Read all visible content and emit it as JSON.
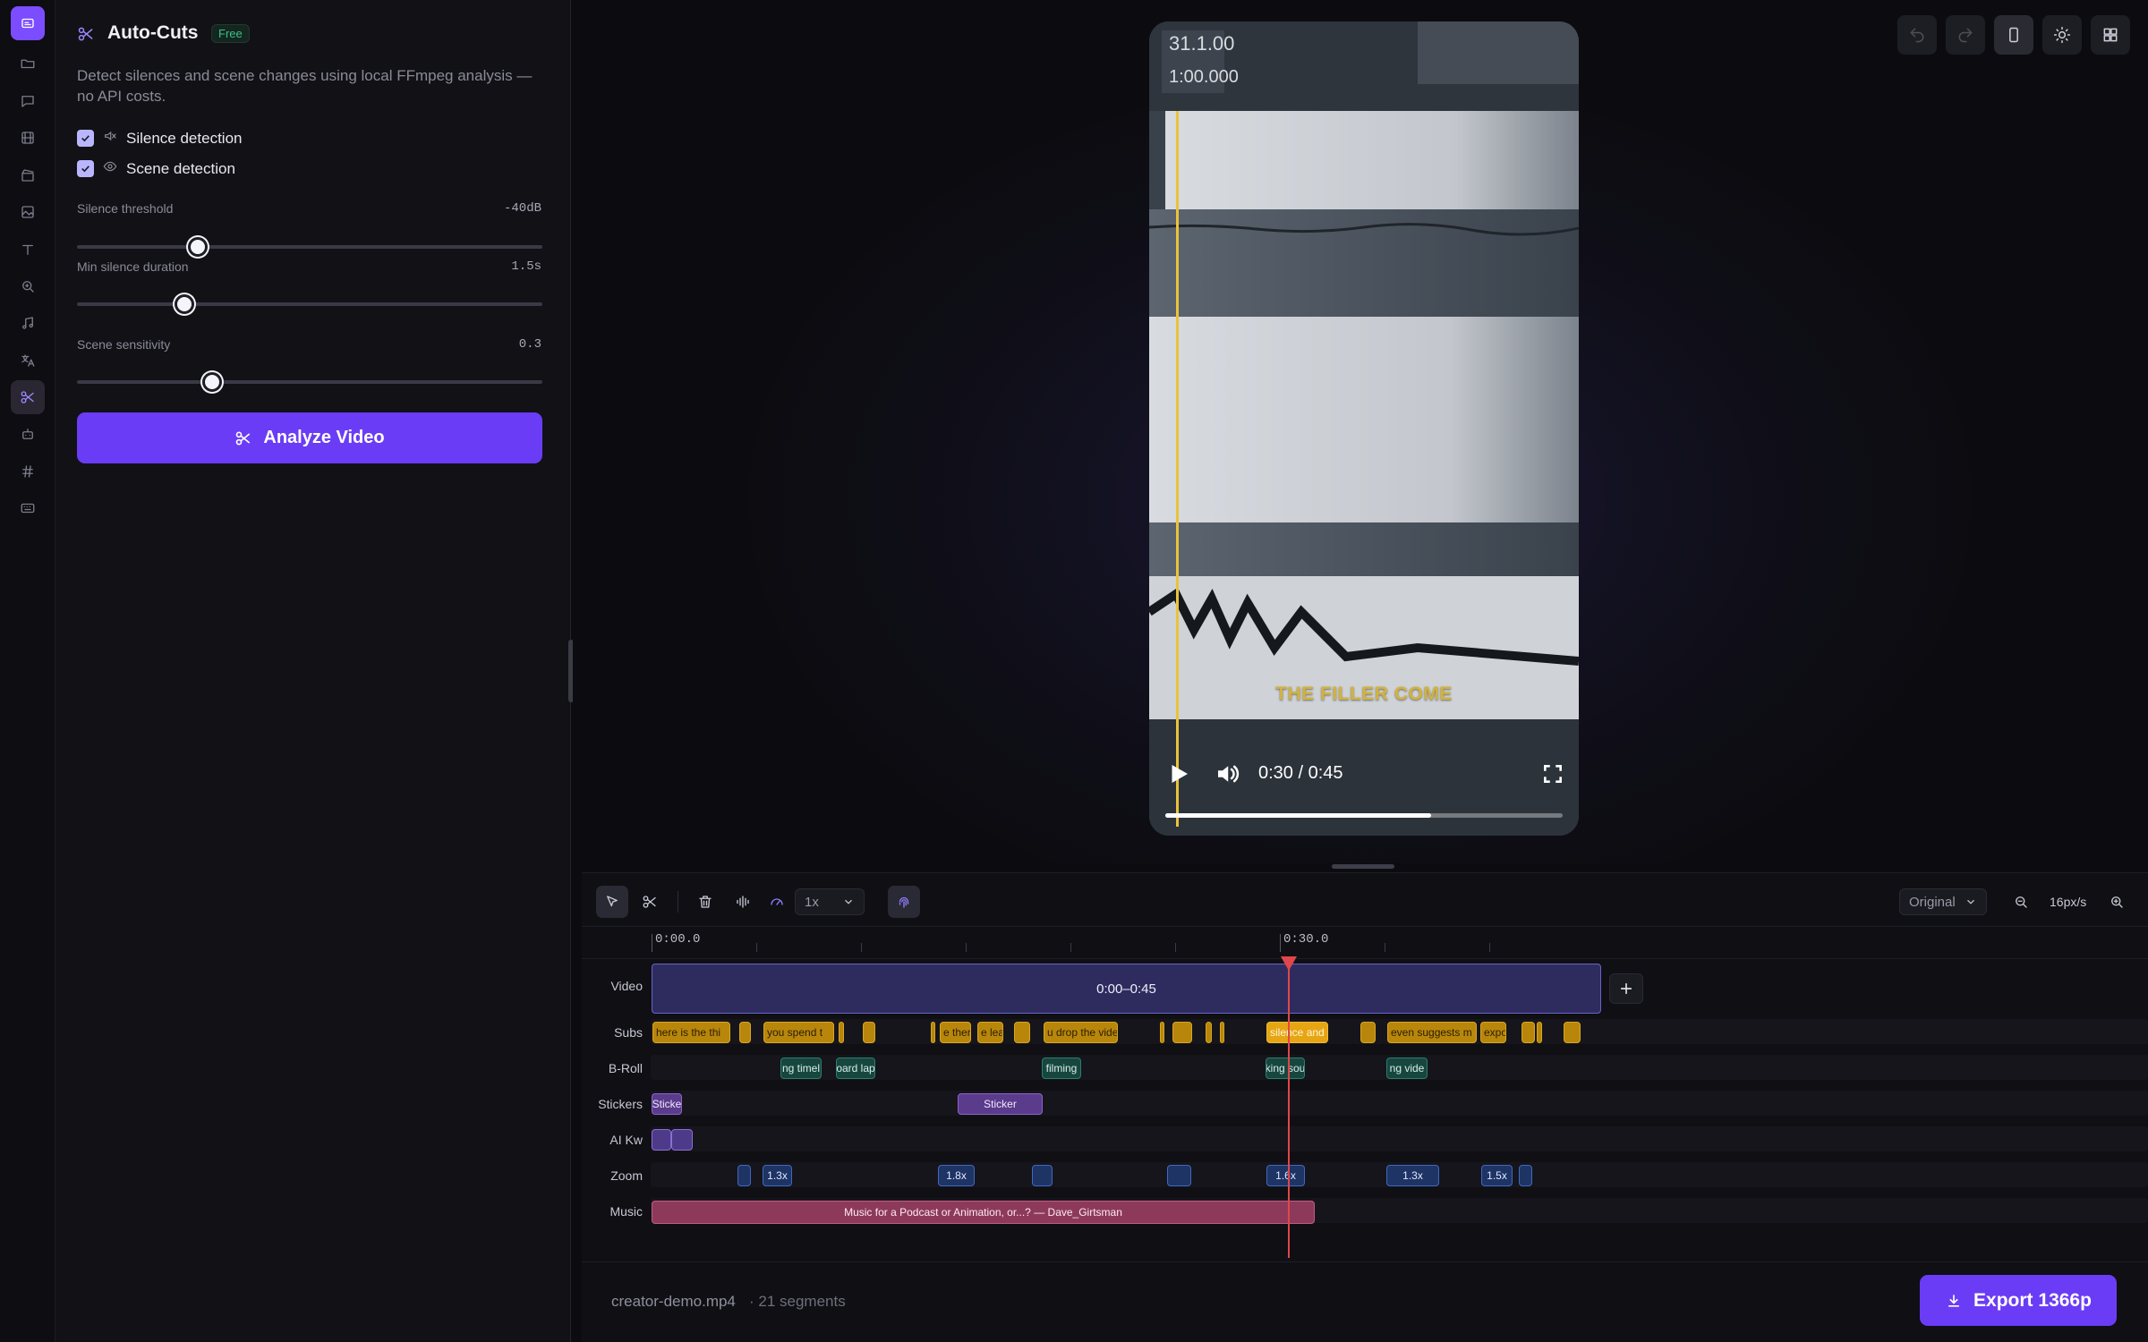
{
  "panel": {
    "title": "Auto-Cuts",
    "badge": "Free",
    "description": "Detect silences and scene changes using local FFmpeg analysis — no API costs.",
    "options": [
      {
        "label": "Silence detection",
        "checked": true,
        "icon": "mute-icon"
      },
      {
        "label": "Scene detection",
        "checked": true,
        "icon": "eye-icon"
      }
    ],
    "sliders": [
      {
        "label": "Silence threshold",
        "value": "-40dB",
        "fraction": 0.26
      },
      {
        "label": "Min silence duration",
        "value": "1.5s",
        "fraction": 0.23
      },
      {
        "label": "Scene sensitivity",
        "value": "0.3",
        "fraction": 0.29
      }
    ],
    "analyze_label": "Analyze Video"
  },
  "player": {
    "caption": "THE FILLER COME",
    "time": "0:30 / 0:45",
    "progress": 0.67,
    "overlay_text_1": "31.1.00",
    "overlay_text_2": "1:00.000"
  },
  "toolbar": {
    "speed": "1x",
    "aspect": "Original",
    "zoom_level": "16px/s"
  },
  "ruler": {
    "start": "0:00.0",
    "mid": "0:30.0"
  },
  "tracks": {
    "video_label": "Video",
    "subs_label": "Subs",
    "broll_label": "B-Roll",
    "stickers_label": "Stickers",
    "ai_label": "AI Kw",
    "zoom_label": "Zoom",
    "music_label": "Music",
    "video_clip": "0:00–0:45",
    "subs": [
      "here is the thi",
      "",
      "you spend t",
      "",
      "",
      "",
      "e ther",
      "e leas",
      "",
      "u drop the vide",
      "",
      "",
      "",
      "",
      "silence and",
      "",
      "even suggests m",
      "expo",
      "",
      "",
      ""
    ],
    "broll": [
      "ng timel",
      "oard lap",
      "filming",
      "king sou",
      "ng vide"
    ],
    "stickers": [
      "Sticke",
      "Sticker"
    ],
    "zoom": [
      "",
      "1.3x",
      "1.8x",
      "",
      "",
      "1.6x",
      "1.3x",
      "1.5x",
      ""
    ],
    "music": "Music for a Podcast or Animation, or...? — Dave_Girtsman"
  },
  "footer": {
    "filename": "creator-demo.mp4",
    "segments": "· 21 segments",
    "export_label": "Export 1366p"
  },
  "colors": {
    "accent": "#6b3cf5",
    "playhead": "#e0474a",
    "subs": "#b8860b",
    "music": "#8d3a5a"
  }
}
